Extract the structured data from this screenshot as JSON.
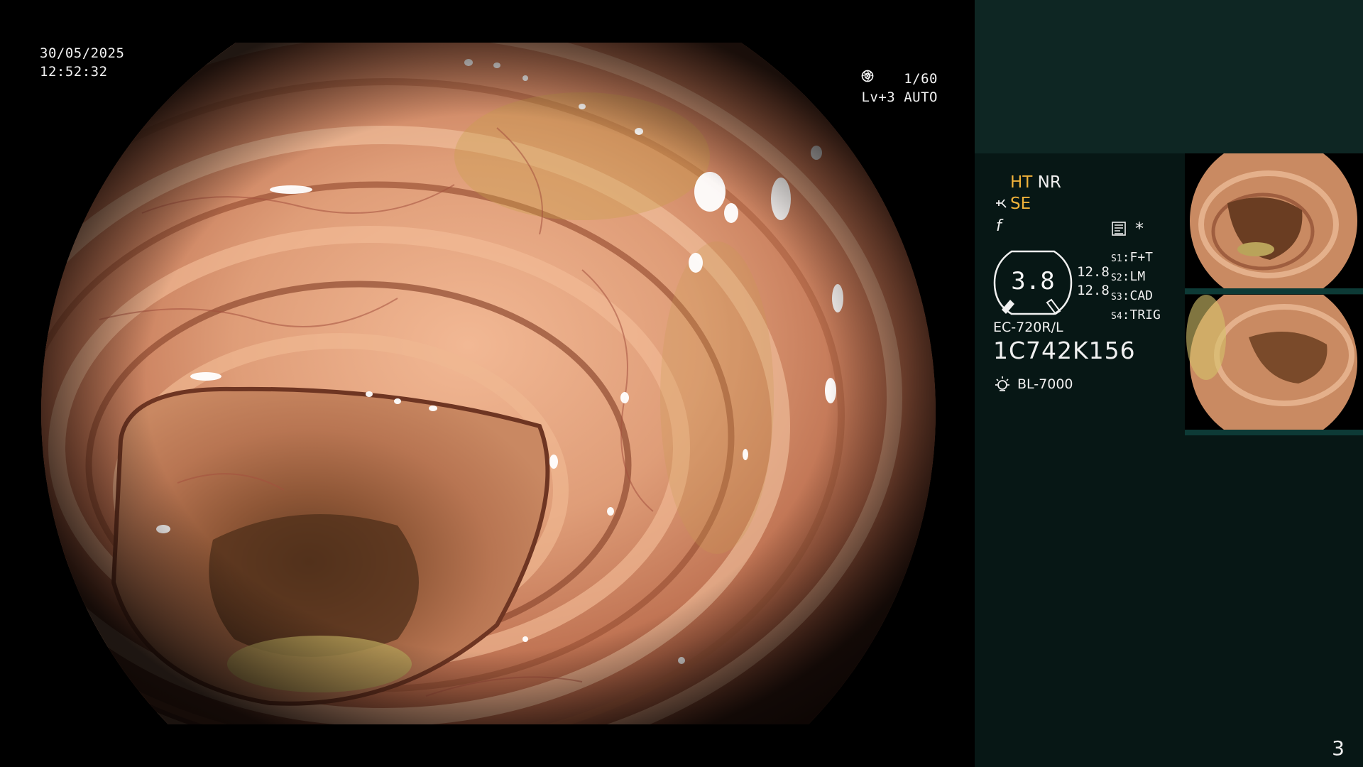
{
  "datetime": {
    "date": "30/05/2025",
    "time": "12:52:32"
  },
  "exposure": {
    "shutter": "1/60",
    "level": "Lv+3",
    "mode": "AUTO"
  },
  "panel": {
    "ht": "HT",
    "nr": "NR",
    "se": "SE",
    "f_symbol": "f",
    "asterisk": "*",
    "gauge_value": "3.8",
    "gauge_num_1": "12.8",
    "gauge_num_2": "12.8",
    "switches": [
      {
        "key": "S1",
        "value": "F+T"
      },
      {
        "key": "S2",
        "value": "LM"
      },
      {
        "key": "S3",
        "value": "CAD"
      },
      {
        "key": "S4",
        "value": "TRIG"
      }
    ],
    "scope_model": "EC-720R/L",
    "serial": "1C742K156",
    "light_source": "BL-7000"
  },
  "page_number": "3",
  "colors": {
    "panel_bg": "#071715",
    "panel_top_bg": "#0e2623",
    "accent_yellow": "#f0b23a",
    "mucosa": "#d9906c"
  },
  "icons": [
    "shutter-icon",
    "auto-iris-icon",
    "scope-tip-icon",
    "f-icon",
    "record-icon",
    "lamp-icon"
  ]
}
